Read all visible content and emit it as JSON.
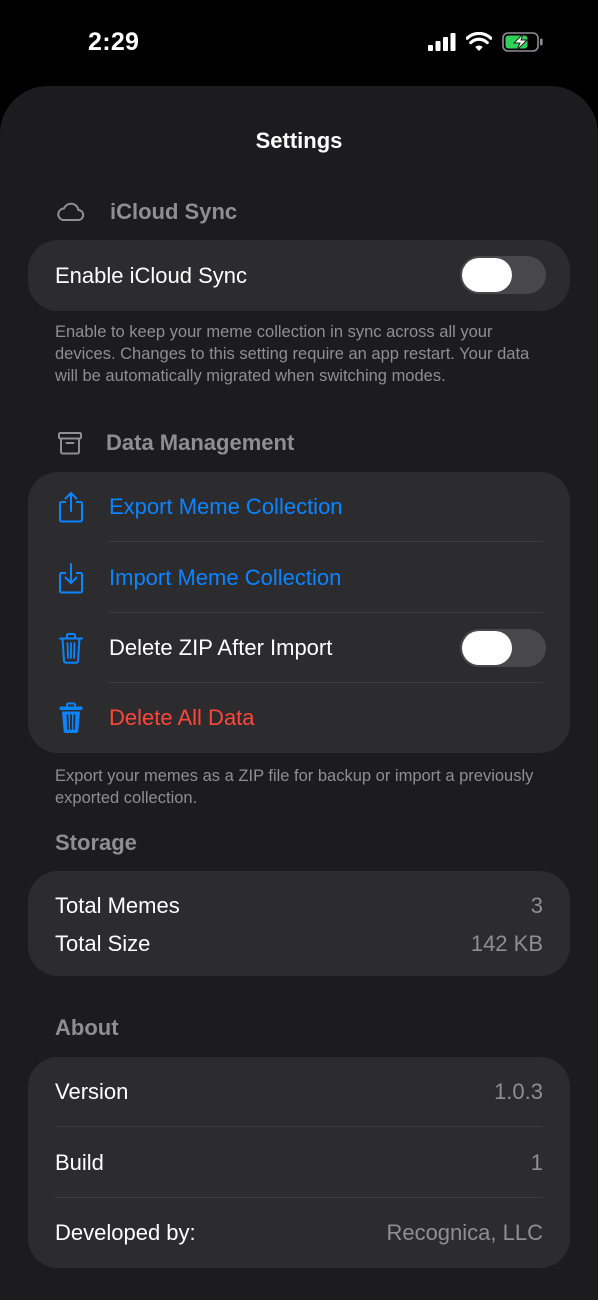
{
  "status_bar": {
    "time": "2:29"
  },
  "header": {
    "title": "Settings"
  },
  "icloud": {
    "section_title": "iCloud Sync",
    "toggle_label": "Enable iCloud Sync",
    "toggle_on": false,
    "footnote": "Enable to keep your meme collection in sync across all your devices. Changes to this setting require an app restart. Your data will be automatically migrated when switching modes."
  },
  "data_management": {
    "section_title": "Data Management",
    "export_label": "Export Meme Collection",
    "import_label": "Import Meme Collection",
    "delete_zip_label": "Delete ZIP After Import",
    "delete_zip_on": false,
    "delete_all_label": "Delete All Data",
    "footnote": "Export your memes as a ZIP file for backup or import a previously exported collection."
  },
  "storage": {
    "section_title": "Storage",
    "total_memes_label": "Total Memes",
    "total_memes_value": "3",
    "total_size_label": "Total Size",
    "total_size_value": "142 KB"
  },
  "about": {
    "section_title": "About",
    "version_label": "Version",
    "version_value": "1.0.3",
    "build_label": "Build",
    "build_value": "1",
    "developer_label": "Developed by:",
    "developer_value": "Recognica, LLC"
  },
  "colors": {
    "accent": "#0a84ff",
    "destructive": "#ff453a",
    "secondary_text": "#8e8e93",
    "card": "#2c2c2e",
    "background": "#1c1c1e",
    "battery_charging": "#30d158"
  },
  "icons": [
    "signal-icon",
    "wifi-icon",
    "battery-charging-icon",
    "cloud-icon",
    "archive-box-icon",
    "share-export-icon",
    "download-import-icon",
    "trash-outline-icon",
    "trash-filled-icon"
  ]
}
